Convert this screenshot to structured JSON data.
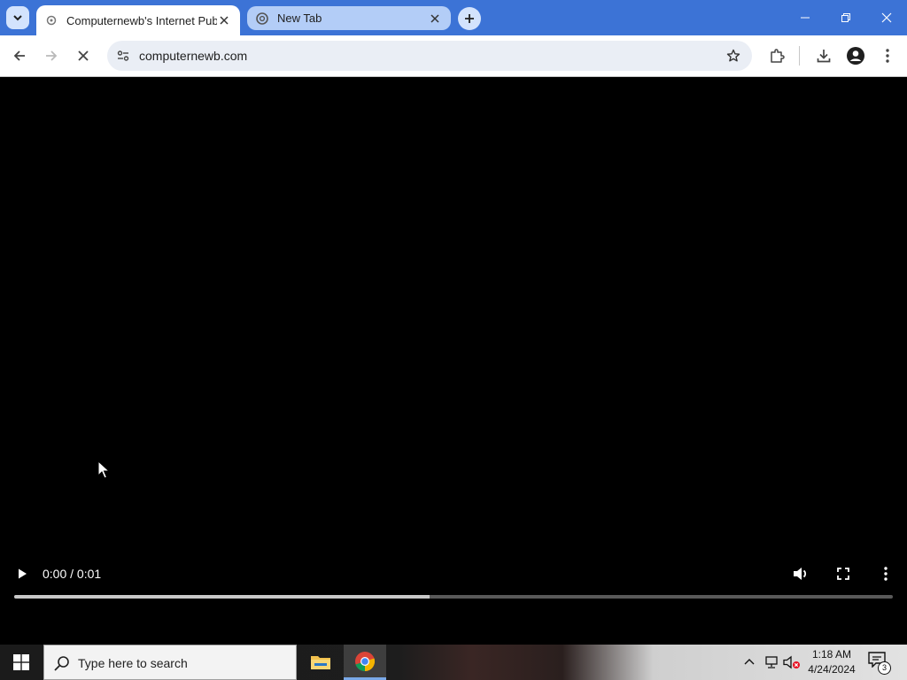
{
  "browser": {
    "tabs": [
      {
        "title": "Computernewb's Internet Pub",
        "active": true,
        "favicon": "site-favicon-icon"
      },
      {
        "title": "New Tab",
        "active": false,
        "favicon": "chrome-icon"
      }
    ],
    "url": "computernewb.com"
  },
  "video": {
    "time": "0:00 / 0:01",
    "progress_fraction": 0.473
  },
  "taskbar": {
    "search_placeholder": "Type here to search",
    "time": "1:18 AM",
    "date": "4/24/2024",
    "notification_count": "3"
  },
  "colors": {
    "tabstrip": "#3c73d6",
    "omnibox": "#eaeef5",
    "video_bg": "#000000"
  }
}
